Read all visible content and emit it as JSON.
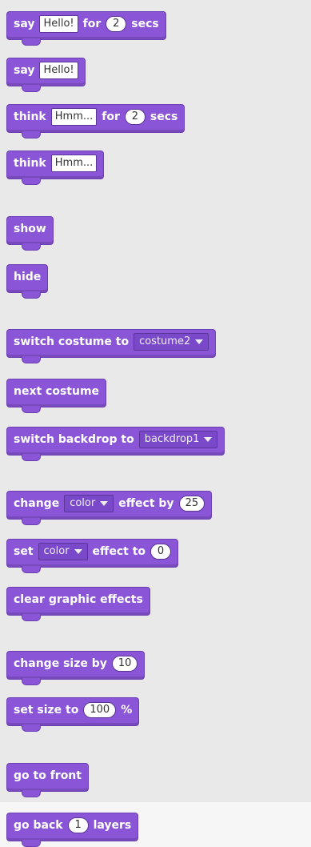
{
  "blocks": {
    "say_for": {
      "say": "say",
      "text": "Hello!",
      "for": "for",
      "num": "2",
      "secs": "secs"
    },
    "say": {
      "say": "say",
      "text": "Hello!"
    },
    "think_for": {
      "think": "think",
      "text": "Hmm...",
      "for": "for",
      "num": "2",
      "secs": "secs"
    },
    "think": {
      "think": "think",
      "text": "Hmm..."
    },
    "show": {
      "label": "show"
    },
    "hide": {
      "label": "hide"
    },
    "switch_costume": {
      "label": "switch costume to",
      "value": "costume2"
    },
    "next_costume": {
      "label": "next costume"
    },
    "switch_backdrop": {
      "label": "switch backdrop to",
      "value": "backdrop1"
    },
    "change_effect": {
      "change": "change",
      "effect": "color",
      "by": "effect by",
      "num": "25"
    },
    "set_effect": {
      "set": "set",
      "effect": "color",
      "to": "effect to",
      "num": "0"
    },
    "clear_effects": {
      "label": "clear graphic effects"
    },
    "change_size": {
      "label": "change size by",
      "num": "10"
    },
    "set_size": {
      "label": "set size to",
      "num": "100",
      "unit": "%"
    },
    "go_front": {
      "label": "go to front"
    },
    "go_back": {
      "go": "go back",
      "num": "1",
      "layers": "layers"
    }
  },
  "colors": {
    "looks_block": "#8a55d7",
    "palette_bg": "#e9e9e9"
  }
}
